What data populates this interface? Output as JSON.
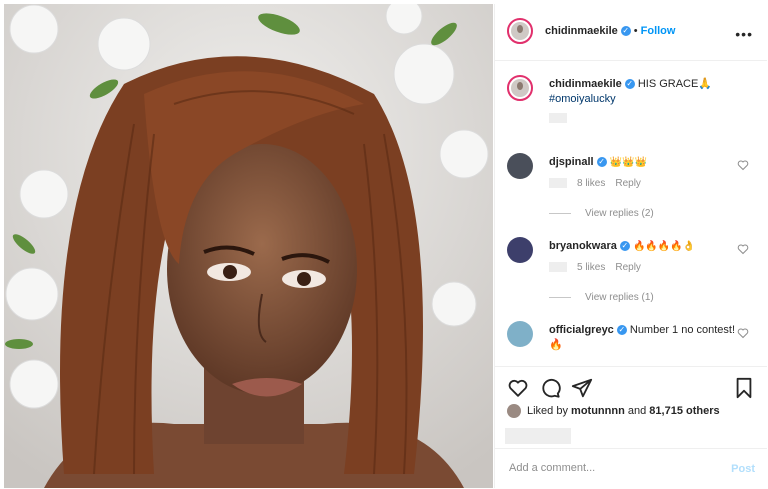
{
  "post": {
    "author": "chidinmaekile",
    "follow_label": "Follow",
    "more_label": "•••",
    "caption_text": "HIS GRACE🙏",
    "caption_tag": "#omoiyalucky"
  },
  "comments": [
    {
      "user": "djspinall",
      "text": "👑👑👑",
      "likes": "8 likes",
      "reply": "Reply",
      "view_replies": "View replies (2)"
    },
    {
      "user": "bryanokwara",
      "text": "🔥🔥🔥🔥👌",
      "likes": "5 likes",
      "reply": "Reply",
      "view_replies": "View replies (1)"
    },
    {
      "user": "officialgreyc",
      "text": "Number 1 no contest! 🔥"
    }
  ],
  "likes_summary": {
    "prefix": "Liked by",
    "user": "motunnnn",
    "middle": "and",
    "count": "81,715 others"
  },
  "add_comment": {
    "placeholder": "Add a comment...",
    "post_label": "Post"
  },
  "colors": {
    "accent": "#0095f6",
    "verified": "#3897f0"
  }
}
